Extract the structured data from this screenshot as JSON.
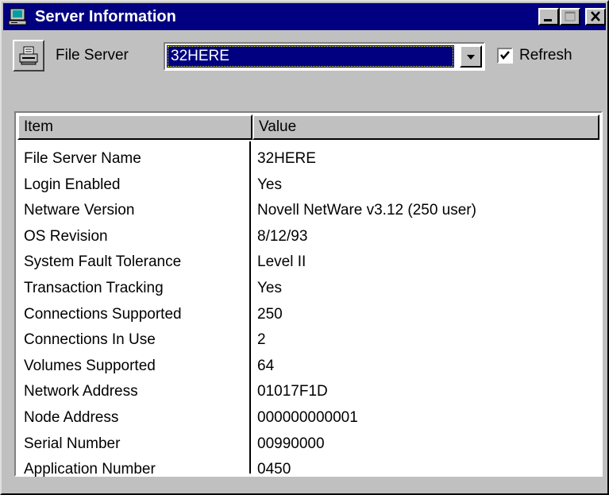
{
  "window": {
    "title": "Server Information"
  },
  "toolbar": {
    "file_server_label": "File Server",
    "file_server_value": "32HERE",
    "refresh_label": "Refresh",
    "refresh_checked": true
  },
  "table": {
    "columns": [
      "Item",
      "Value"
    ],
    "rows": [
      [
        "File Server Name",
        "32HERE"
      ],
      [
        "Login Enabled",
        "Yes"
      ],
      [
        "Netware Version",
        "Novell NetWare v3.12 (250 user)"
      ],
      [
        "OS Revision",
        "8/12/93"
      ],
      [
        "System Fault Tolerance",
        "Level II"
      ],
      [
        "Transaction Tracking",
        "Yes"
      ],
      [
        "Connections Supported",
        "250"
      ],
      [
        "Connections In Use",
        "2"
      ],
      [
        "Volumes Supported",
        "64"
      ],
      [
        "Network Address",
        "01017F1D"
      ],
      [
        "Node Address",
        "000000000001"
      ],
      [
        "Serial Number",
        "00990000"
      ],
      [
        "Application Number",
        "0450"
      ]
    ]
  },
  "colors": {
    "titlebar": "#000080",
    "face": "#c0c0c0",
    "selection": "#000080"
  }
}
